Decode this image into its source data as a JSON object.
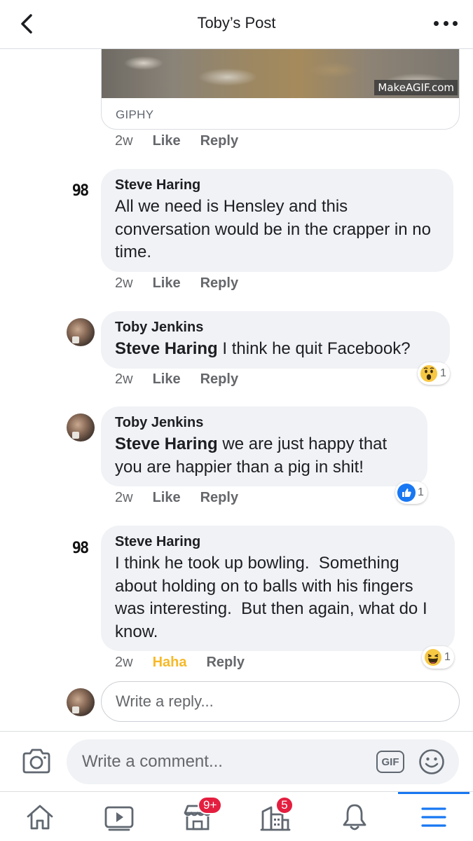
{
  "header": {
    "title": "Toby’s Post"
  },
  "gif": {
    "watermark": "MakeAGIF.com",
    "source": "GIPHY",
    "meta": {
      "time": "2w",
      "like": "Like",
      "reply": "Reply"
    }
  },
  "comments": [
    {
      "author": "Steve Haring",
      "avatar_text": "98",
      "mention": "",
      "text": "All we need is Hensley and this conversation would be in the crapper in no time.",
      "meta": {
        "time": "2w",
        "like": "Like",
        "reply": "Reply"
      }
    },
    {
      "author": "Toby Jenkins",
      "mention": "Steve Haring",
      "text": " I think he quit Facebook?",
      "meta": {
        "time": "2w",
        "like": "Like",
        "reply": "Reply"
      },
      "reaction": {
        "icon": "wow-emoji",
        "count": "1"
      }
    },
    {
      "author": "Toby Jenkins",
      "mention": "Steve Haring",
      "text": " we are just happy that you are happier than a pig in shit!",
      "meta": {
        "time": "2w",
        "like": "Like",
        "reply": "Reply"
      },
      "reaction": {
        "icon": "like-thumb",
        "count": "1"
      }
    },
    {
      "author": "Steve Haring",
      "avatar_text": "98",
      "mention": "",
      "text": "I think he took up bowling.  Something about holding on to balls with his fingers was interesting.  But then again, what do I know.",
      "meta": {
        "time": "2w",
        "like": "Haha",
        "reply": "Reply"
      },
      "reaction": {
        "icon": "haha-emoji",
        "count": "1"
      }
    }
  ],
  "reply_input": {
    "placeholder": "Write a reply..."
  },
  "comment_bar": {
    "placeholder": "Write a comment...",
    "gif_label": "GIF"
  },
  "tabbar": {
    "items": [
      {
        "icon": "home-icon"
      },
      {
        "icon": "watch-icon"
      },
      {
        "icon": "marketplace-icon",
        "badge": "9+"
      },
      {
        "icon": "groups-icon",
        "badge": "5"
      },
      {
        "icon": "bell-icon"
      },
      {
        "icon": "menu-icon"
      }
    ]
  },
  "colors": {
    "accent": "#1877f2",
    "haha_yellow": "#f7b928",
    "badge_red": "#e41e3f",
    "bubble_bg": "#f0f2f5"
  }
}
